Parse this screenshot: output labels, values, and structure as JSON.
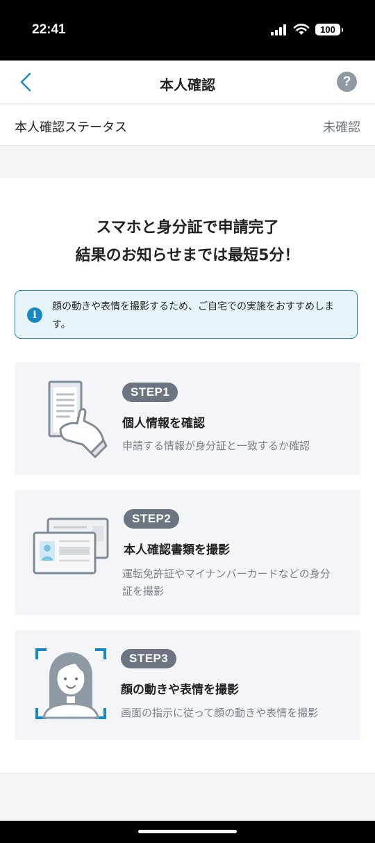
{
  "status_bar": {
    "time": "22:41",
    "battery": "100"
  },
  "nav": {
    "title": "本人確認",
    "help": "?"
  },
  "verification_status": {
    "label": "本人確認ステータス",
    "value": "未確認"
  },
  "headline": {
    "line1": "スマホと身分証で申請完了",
    "line2": "結果のお知らせまでは最短5分！"
  },
  "notice": {
    "icon": "i",
    "text": "顔の動きや表情を撮影するため、ご自宅での実施をおすすめします。"
  },
  "steps": [
    {
      "badge": "STEP1",
      "title": "個人情報を確認",
      "description": "申請する情報が身分証と一致するか確認",
      "icon": "document-in-hand-icon"
    },
    {
      "badge": "STEP2",
      "title": "本人確認書類を撮影",
      "description": "運転免許証やマイナンバーカードなどの身分証を撮影",
      "icon": "id-cards-icon"
    },
    {
      "badge": "STEP3",
      "title": "顔の動きや表情を撮影",
      "description": "画面の指示に従って顔の動きや表情を撮影",
      "icon": "face-capture-icon"
    }
  ],
  "colors": {
    "accent": "#1788c2",
    "badge": "#6b7480",
    "step_bg": "#f3f5f8",
    "notice_bg": "#e6f4fa"
  }
}
